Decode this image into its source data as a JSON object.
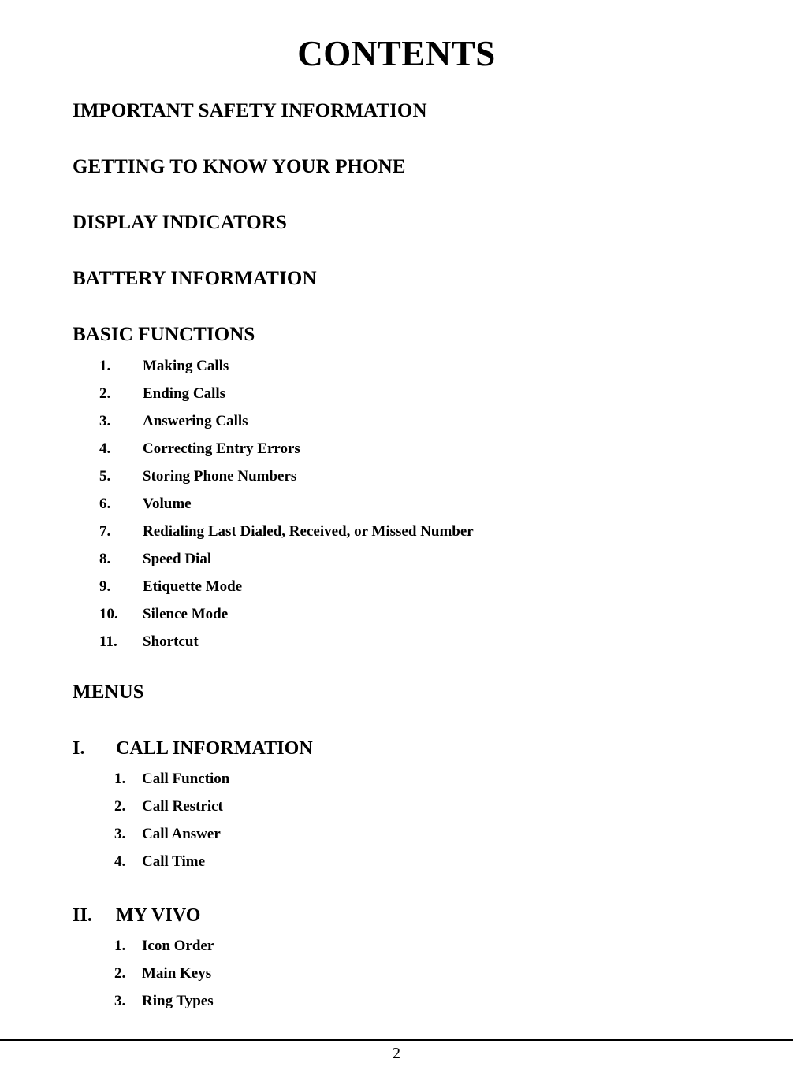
{
  "document": {
    "title": "CONTENTS",
    "page_number": "2"
  },
  "sections": [
    {
      "heading": "IMPORTANT SAFETY INFORMATION"
    },
    {
      "heading": "GETTING TO KNOW YOUR PHONE"
    },
    {
      "heading": "DISPLAY INDICATORS"
    },
    {
      "heading": "BATTERY INFORMATION"
    }
  ],
  "basic_functions": {
    "heading": "BASIC FUNCTIONS",
    "items": [
      {
        "num": "1.",
        "label": "Making Calls"
      },
      {
        "num": "2.",
        "label": "Ending Calls"
      },
      {
        "num": "3.",
        "label": "Answering Calls"
      },
      {
        "num": "4.",
        "label": "Correcting Entry Errors"
      },
      {
        "num": "5.",
        "label": "Storing Phone Numbers"
      },
      {
        "num": "6.",
        "label": "Volume"
      },
      {
        "num": "7.",
        "label": "Redialing Last Dialed, Received, or Missed Number"
      },
      {
        "num": "8.",
        "label": "Speed Dial"
      },
      {
        "num": "9.",
        "label": "Etiquette Mode"
      },
      {
        "num": "10.",
        "label": "Silence Mode"
      },
      {
        "num": "11.",
        "label": "Shortcut"
      }
    ]
  },
  "menus": {
    "heading": "MENUS",
    "groups": [
      {
        "numeral": "I.",
        "title": "CALL INFORMATION",
        "items": [
          {
            "num": "1.",
            "label": "Call Function"
          },
          {
            "num": "2.",
            "label": "Call Restrict"
          },
          {
            "num": "3.",
            "label": "Call Answer"
          },
          {
            "num": "4.",
            "label": "Call Time"
          }
        ]
      },
      {
        "numeral": "II.",
        "title": "MY VIVO",
        "items": [
          {
            "num": "1.",
            "label": "Icon Order"
          },
          {
            "num": "2.",
            "label": "Main Keys"
          },
          {
            "num": "3.",
            "label": "Ring Types"
          }
        ]
      }
    ]
  }
}
